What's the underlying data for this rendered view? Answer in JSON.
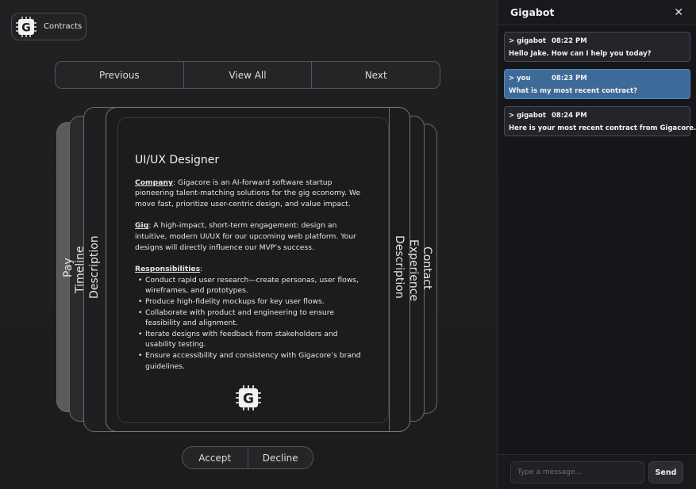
{
  "brand": {
    "label": "Contracts",
    "logo_letter": "G",
    "logo_icon": "chip-logo-icon"
  },
  "nav": {
    "previous": "Previous",
    "view_all": "View All",
    "next": "Next"
  },
  "tabs": {
    "left": [
      "Pay",
      "Timeline",
      "Description"
    ],
    "right": [
      "Description",
      "Experience",
      "Contact"
    ]
  },
  "contract": {
    "title": "UI/UX Designer",
    "company_label": "Company",
    "company_text": ": Gigacore is an AI-forward software startup pioneering talent-matching solutions for the gig economy. We move fast, prioritize user-centric design, and value impact.",
    "gig_label": "Gig",
    "gig_text": ": A high-impact, short-term engagement: design an intuitive, modern UI/UX for our upcoming web platform. Your designs will directly influence our MVP’s success.",
    "responsibilities_label": "Responsibilities",
    "responsibilities_suffix": ":",
    "responsibilities": [
      "Conduct rapid user research—create personas, user flows, wireframes, and prototypes.",
      "Produce high-fidelity mockups for key user flows.",
      "Collaborate with product and engineering to ensure feasibility and alignment.",
      "Iterate designs with feedback from stakeholders and usability testing.",
      "Ensure accessibility and consistency with Gigacore’s brand guidelines."
    ]
  },
  "actions": {
    "accept": "Accept",
    "decline": "Decline"
  },
  "chat": {
    "title": "Gigabot",
    "close_icon": "close-icon",
    "messages": [
      {
        "sender": "> gigabot",
        "time": "08:22 PM",
        "text": "Hello Jake. How can I help you today?",
        "from_user": false
      },
      {
        "sender": "> you",
        "time": "08:23 PM",
        "text": "What is my most recent contract?",
        "from_user": true
      },
      {
        "sender": "> gigabot",
        "time": "08:24 PM",
        "text": "Here is your most recent contract from Gigacore.",
        "from_user": false
      }
    ],
    "input_placeholder": "Type a message...",
    "send_label": "Send"
  },
  "colors": {
    "background": "#1c1c1e",
    "chat_background": "#14161a",
    "user_message": "#3d6a99",
    "bot_message": "#23252a"
  }
}
